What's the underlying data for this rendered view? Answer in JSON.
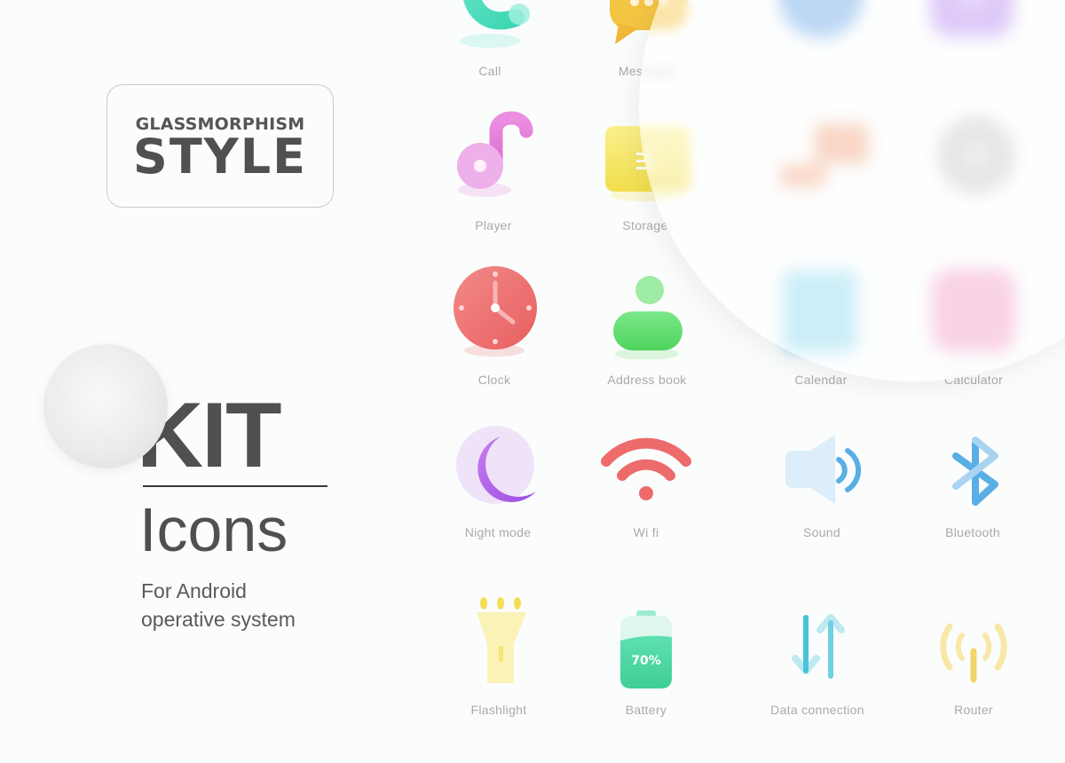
{
  "header": {
    "style_label_small": "GLASSMORPHISM",
    "style_label_big": "STYLE"
  },
  "title": {
    "kit": "KIT",
    "icons": "Icons",
    "subtitle_line1": "For Android",
    "subtitle_line2": "operative system"
  },
  "icons": [
    {
      "name": "call",
      "label": "Call",
      "color": "#4fdcc0"
    },
    {
      "name": "messages",
      "label": "Messages",
      "color": "#f4c542"
    },
    {
      "name": "browser",
      "label": "",
      "color": "#6aa8e8"
    },
    {
      "name": "camera",
      "label": "",
      "color": "#b58af0"
    },
    {
      "name": "player",
      "label": "Player",
      "color": "#e27ad8"
    },
    {
      "name": "storage",
      "label": "Storage",
      "color": "#f3e24f"
    },
    {
      "name": "gallery",
      "label": "",
      "color": "#f2a27c"
    },
    {
      "name": "settings",
      "label": "",
      "color": "#c8c8c8"
    },
    {
      "name": "clock",
      "label": "Clock",
      "color": "#ee6b6b"
    },
    {
      "name": "address-book",
      "label": "Address book",
      "color": "#5dd96b"
    },
    {
      "name": "calendar",
      "label": "Calendar",
      "color": "#8ed9f0"
    },
    {
      "name": "calculator",
      "label": "Calculator",
      "color": "#f29cc7"
    },
    {
      "name": "night-mode",
      "label": "Night mode",
      "color": "#b265e8"
    },
    {
      "name": "wifi",
      "label": "Wi fi",
      "color": "#ee6b6b"
    },
    {
      "name": "sound",
      "label": "Sound",
      "color": "#5aaee6"
    },
    {
      "name": "bluetooth",
      "label": "Bluetooth",
      "color": "#5aaee6"
    },
    {
      "name": "flashlight",
      "label": "Flashlight",
      "color": "#f3de55"
    },
    {
      "name": "battery",
      "label": "Battery",
      "color": "#4fd6a2",
      "value": "70%"
    },
    {
      "name": "data-connection",
      "label": "Data connection",
      "color": "#4ac3d8"
    },
    {
      "name": "router",
      "label": "Router",
      "color": "#f3d46a"
    }
  ]
}
